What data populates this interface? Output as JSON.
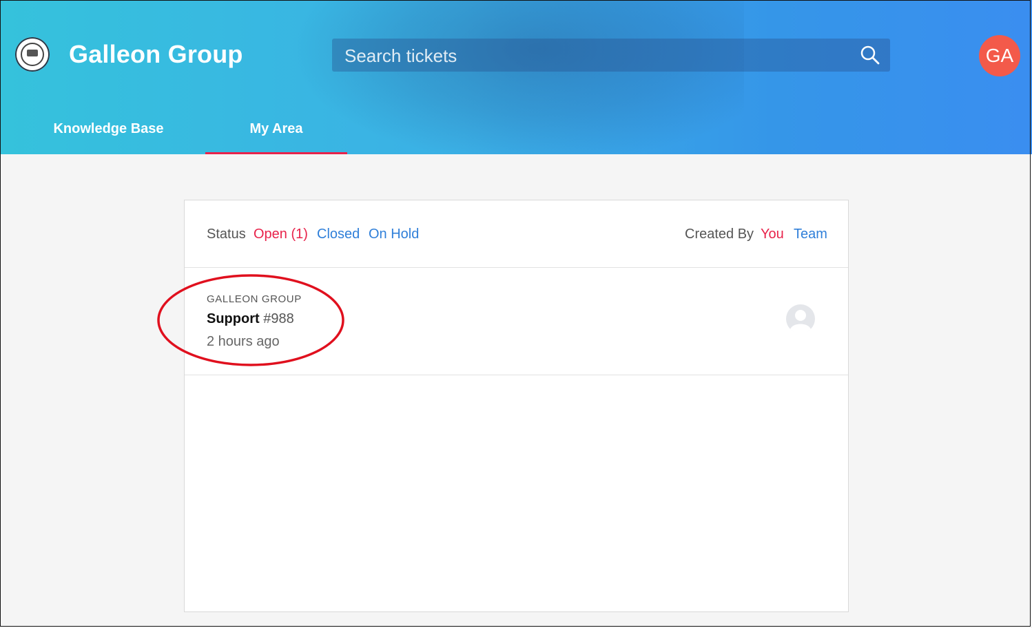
{
  "header": {
    "brand": "Galleon Group",
    "search_placeholder": "Search tickets",
    "user_initials": "GA",
    "tabs": [
      {
        "label": "Knowledge Base",
        "active": false
      },
      {
        "label": "My Area",
        "active": true
      }
    ],
    "colors": {
      "gradient_start": "#35c2dc",
      "gradient_end": "#3a8ef0",
      "active_tab_underline": "#e8224a",
      "avatar_bg": "#f35a4a"
    }
  },
  "filters": {
    "status_label": "Status",
    "open": "Open (1)",
    "closed": "Closed",
    "on_hold": "On Hold",
    "created_by_label": "Created By",
    "you": "You",
    "team": "Team",
    "colors": {
      "active": "#e8224a",
      "link": "#2f7fd9"
    }
  },
  "tickets": [
    {
      "organization": "GALLEON GROUP",
      "subject": "Support",
      "number": "#988",
      "time": "2 hours ago",
      "assignee_icon": "user-placeholder-icon"
    }
  ],
  "annotation": {
    "shape": "ellipse",
    "color": "#e0101e"
  }
}
